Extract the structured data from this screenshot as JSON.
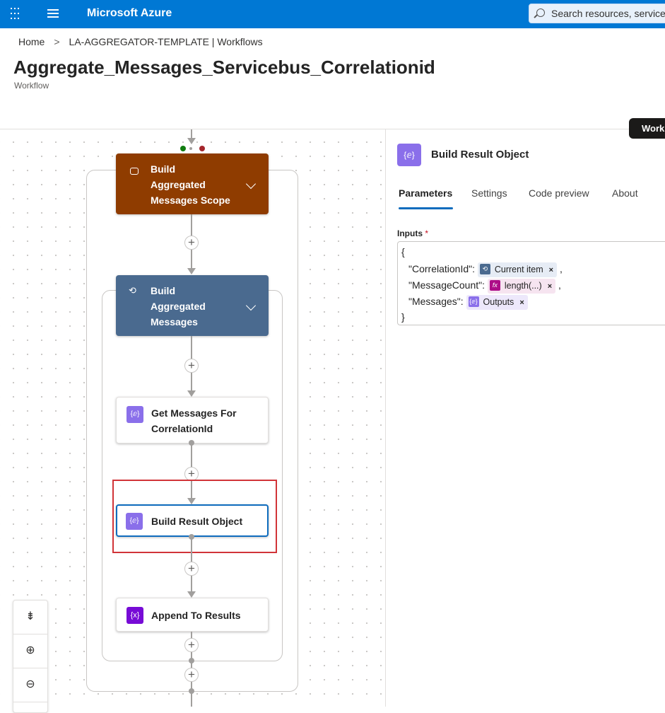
{
  "topbar": {
    "brand": "Microsoft Azure",
    "search_placeholder": "Search resources, services,"
  },
  "breadcrumb": {
    "items": [
      "Home",
      "LA-AGGREGATOR-TEMPLATE | Workflows"
    ],
    "separator": ">"
  },
  "header": {
    "title": "Aggregate_Messages_Servicebus_Correlationid",
    "more": "···",
    "subtitle": "Workflow",
    "work_tag": "Work"
  },
  "canvas": {
    "nodes": [
      {
        "id": "scope",
        "label_lines": [
          "Build",
          "Aggregated",
          "Messages Scope"
        ],
        "color": "#8f3c00"
      },
      {
        "id": "foreach",
        "label_lines": [
          "Build",
          "Aggregated",
          "Messages"
        ],
        "color": "#4a6a8f"
      },
      {
        "id": "get-messages",
        "label_lines": [
          "Get Messages For",
          "CorrelationId"
        ]
      },
      {
        "id": "build-result",
        "label_lines": [
          "Build Result Object"
        ]
      },
      {
        "id": "append",
        "label_lines": [
          "Append To Results"
        ]
      }
    ],
    "plus": "+",
    "zoom_controls": [
      "fit",
      "zoom-in",
      "zoom-out"
    ]
  },
  "panel": {
    "title": "Build Result Object",
    "tabs": [
      "Parameters",
      "Settings",
      "Code preview",
      "About"
    ],
    "active_tab": "Parameters",
    "inputs_label": "Inputs",
    "required_mark": "*",
    "code": {
      "open": "{",
      "close": "}",
      "rows": [
        {
          "key": "\"CorrelationId\":",
          "token": "Current item",
          "suffix": ","
        },
        {
          "key": "\"MessageCount\":",
          "token": "length(...)",
          "suffix": ","
        },
        {
          "key": "\"Messages\":",
          "token": "Outputs",
          "suffix": ""
        }
      ],
      "remove": "×"
    }
  },
  "colors": {
    "azure_blue": "#0078d4",
    "scope": "#8f3c00",
    "foreach": "#4a6a8f",
    "compose": "#8a6fea",
    "variable": "#770bd6",
    "highlight": "#d13438",
    "selected": "#0f6cbd"
  }
}
